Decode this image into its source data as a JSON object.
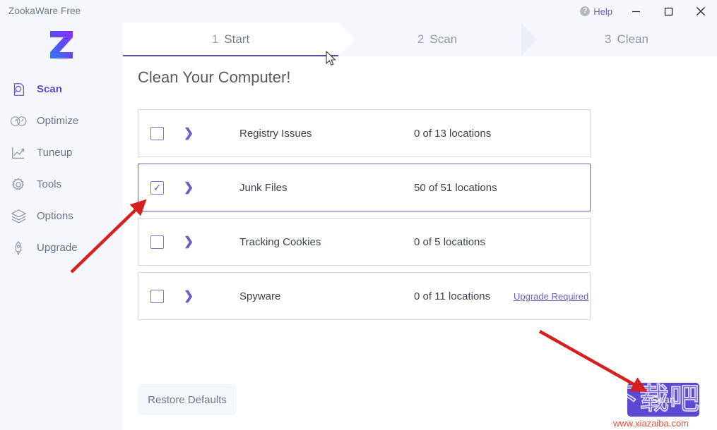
{
  "window": {
    "app_title": "ZookaWare Free",
    "help_label": "Help",
    "help_icon": "question-circle-icon",
    "minimize_icon": "minimize-icon",
    "maximize_icon": "maximize-icon",
    "close_icon": "close-icon"
  },
  "brand": {
    "logo_letter": "Z",
    "logo_gradient_from": "#2f7ef5",
    "logo_gradient_to": "#7b2ff7",
    "accent": "#6a5fc4",
    "button_purple": "#5b4ad4"
  },
  "sidebar": {
    "items": [
      {
        "label": "Scan",
        "icon": "scan-document-magnifier-icon",
        "active": true
      },
      {
        "label": "Optimize",
        "icon": "gauges-icon",
        "active": false
      },
      {
        "label": "Tuneup",
        "icon": "line-chart-icon",
        "active": false
      },
      {
        "label": "Tools",
        "icon": "gear-icon",
        "active": false
      },
      {
        "label": "Options",
        "icon": "layers-icon",
        "active": false
      },
      {
        "label": "Upgrade",
        "icon": "rocket-icon",
        "active": false
      }
    ]
  },
  "steps": [
    {
      "number": "1",
      "label": "Start",
      "active": true
    },
    {
      "number": "2",
      "label": "Scan",
      "active": false
    },
    {
      "number": "3",
      "label": "Clean",
      "active": false
    }
  ],
  "main": {
    "page_title": "Clean Your Computer!",
    "rows": [
      {
        "name": "Registry Issues",
        "count": "0 of 13 locations",
        "checked": false,
        "selected": false,
        "link": ""
      },
      {
        "name": "Junk Files",
        "count": "50 of 51 locations",
        "checked": true,
        "selected": true,
        "link": ""
      },
      {
        "name": "Tracking Cookies",
        "count": "0 of 5 locations",
        "checked": false,
        "selected": false,
        "link": ""
      },
      {
        "name": "Spyware",
        "count": "0 of 11 locations",
        "checked": false,
        "selected": false,
        "link": "Upgrade Required"
      }
    ],
    "restore_label": "Restore Defaults",
    "scan_label": "Scan"
  },
  "watermark": {
    "text_cn": "下载吧",
    "url": "www.xiazaiba.com"
  }
}
